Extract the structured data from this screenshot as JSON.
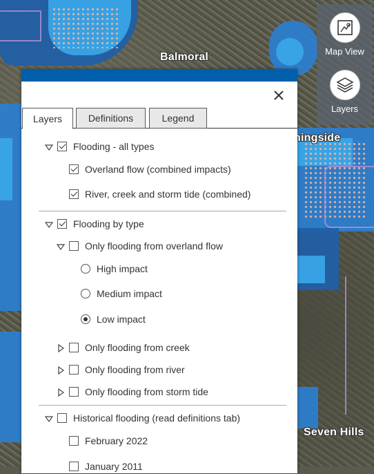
{
  "map": {
    "places": [
      "Balmoral",
      "ningside",
      "Seven Hills"
    ]
  },
  "tools": {
    "map_view_label": "Map View",
    "layers_label": "Layers"
  },
  "panel": {
    "tabs": [
      {
        "label": "Layers",
        "active": true
      },
      {
        "label": "Definitions",
        "active": false
      },
      {
        "label": "Legend",
        "active": false
      }
    ],
    "groups": {
      "all_types": {
        "label": "Flooding - all types",
        "checked": true,
        "items": [
          {
            "label": "Overland flow (combined impacts)",
            "checked": true
          },
          {
            "label": "River, creek and storm tide (combined)",
            "checked": true
          }
        ]
      },
      "by_type": {
        "label": "Flooding by type",
        "checked": true,
        "overland": {
          "label": "Only flooding from overland flow",
          "checked": false,
          "impacts": [
            {
              "label": "High impact",
              "selected": false
            },
            {
              "label": "Medium impact",
              "selected": false
            },
            {
              "label": "Low impact",
              "selected": true
            }
          ]
        },
        "others": [
          {
            "label": "Only flooding from creek",
            "checked": false
          },
          {
            "label": "Only flooding from river",
            "checked": false
          },
          {
            "label": "Only flooding from storm tide",
            "checked": false
          }
        ]
      },
      "historical": {
        "label": "Historical flooding (read definitions tab)",
        "checked": false,
        "items": [
          {
            "label": "February 2022",
            "checked": false
          },
          {
            "label": "January 2011",
            "checked": false
          }
        ]
      }
    }
  },
  "colors": {
    "header_blue": "#005eab",
    "flood_blue": "#2b7fd0",
    "flood_light": "#3aa7e8"
  }
}
